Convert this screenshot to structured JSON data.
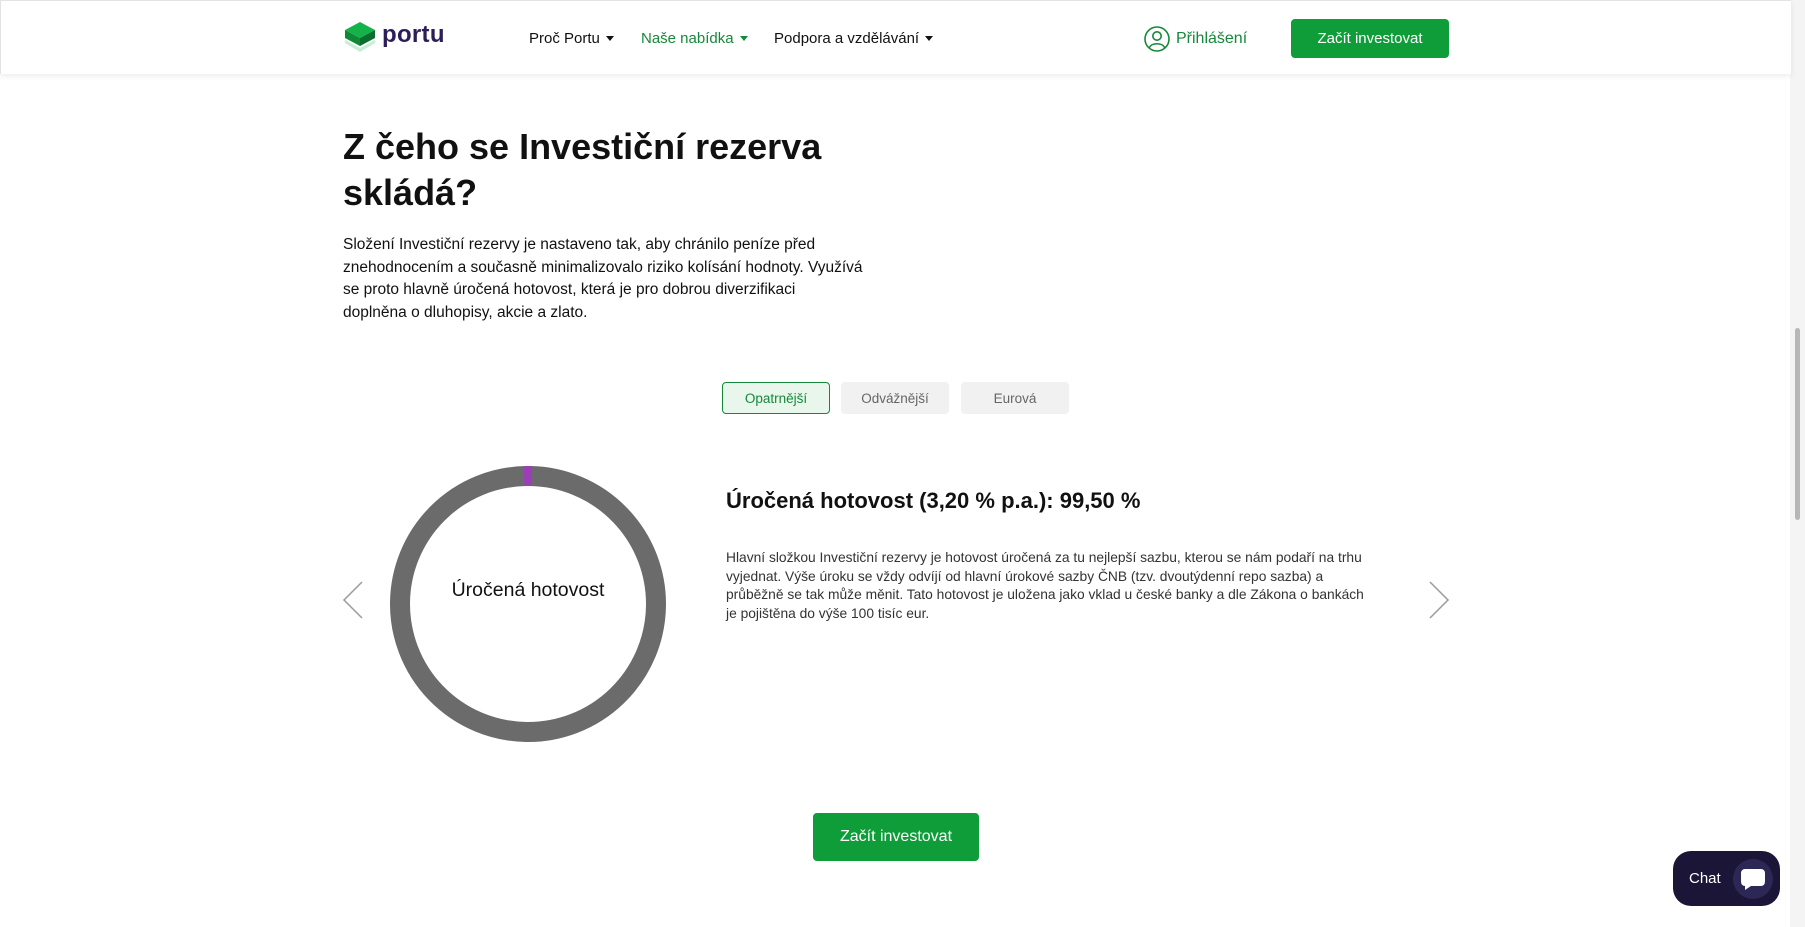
{
  "header": {
    "brand": "portu",
    "nav": [
      {
        "label": "Proč Portu",
        "active": false
      },
      {
        "label": "Naše nabídka",
        "active": true
      },
      {
        "label": "Podpora a vzdělávání",
        "active": false
      }
    ],
    "login_label": "Přihlášení",
    "cta_label": "Začít investovat"
  },
  "section": {
    "title": "Z čeho se Investiční rezerva skládá?",
    "intro": "Složení Investiční rezervy je nastaveno tak, aby chránilo peníze před znehodnocením a současně minimalizovalo riziko kolísání hodnoty. Využívá se proto hlavně úročená hotovost, která je pro dobrou diverzifikaci doplněna o dluhopisy, akcie a zlato."
  },
  "tabs": [
    {
      "label": "Opatrnější",
      "active": true
    },
    {
      "label": "Odvážnější",
      "active": false
    },
    {
      "label": "Eurová",
      "active": false
    }
  ],
  "donut": {
    "center_label": "Úročená hotovost",
    "segments": [
      {
        "share": 99.5,
        "color": "#6b6b6b"
      },
      {
        "share": 0.5,
        "color": "#9b3fb8"
      }
    ]
  },
  "segment_detail": {
    "title": "Úročená hotovost (3,20 % p.a.): 99,50 %",
    "description": "Hlavní složkou Investiční rezervy je hotovost úročená za tu nejlepší sazbu, kterou se nám podaří na trhu vyjednat. Výše úroku se vždy odvíjí od hlavní úrokové sazby ČNB (tzv. dvoutýdenní repo sazba) a průběžně se tak může měnit. Tato hotovost je uložena jako vklad u české banky a dle Zákona o bankách je pojištěna do výše 100 tisíc eur."
  },
  "cta_label": "Začít investovat",
  "chat_label": "Chat",
  "colors": {
    "brand_green": "#0f9d3a",
    "active_green": "#16883a",
    "brand_purple": "#2d1e5a",
    "chat_bg": "#1b1638"
  }
}
